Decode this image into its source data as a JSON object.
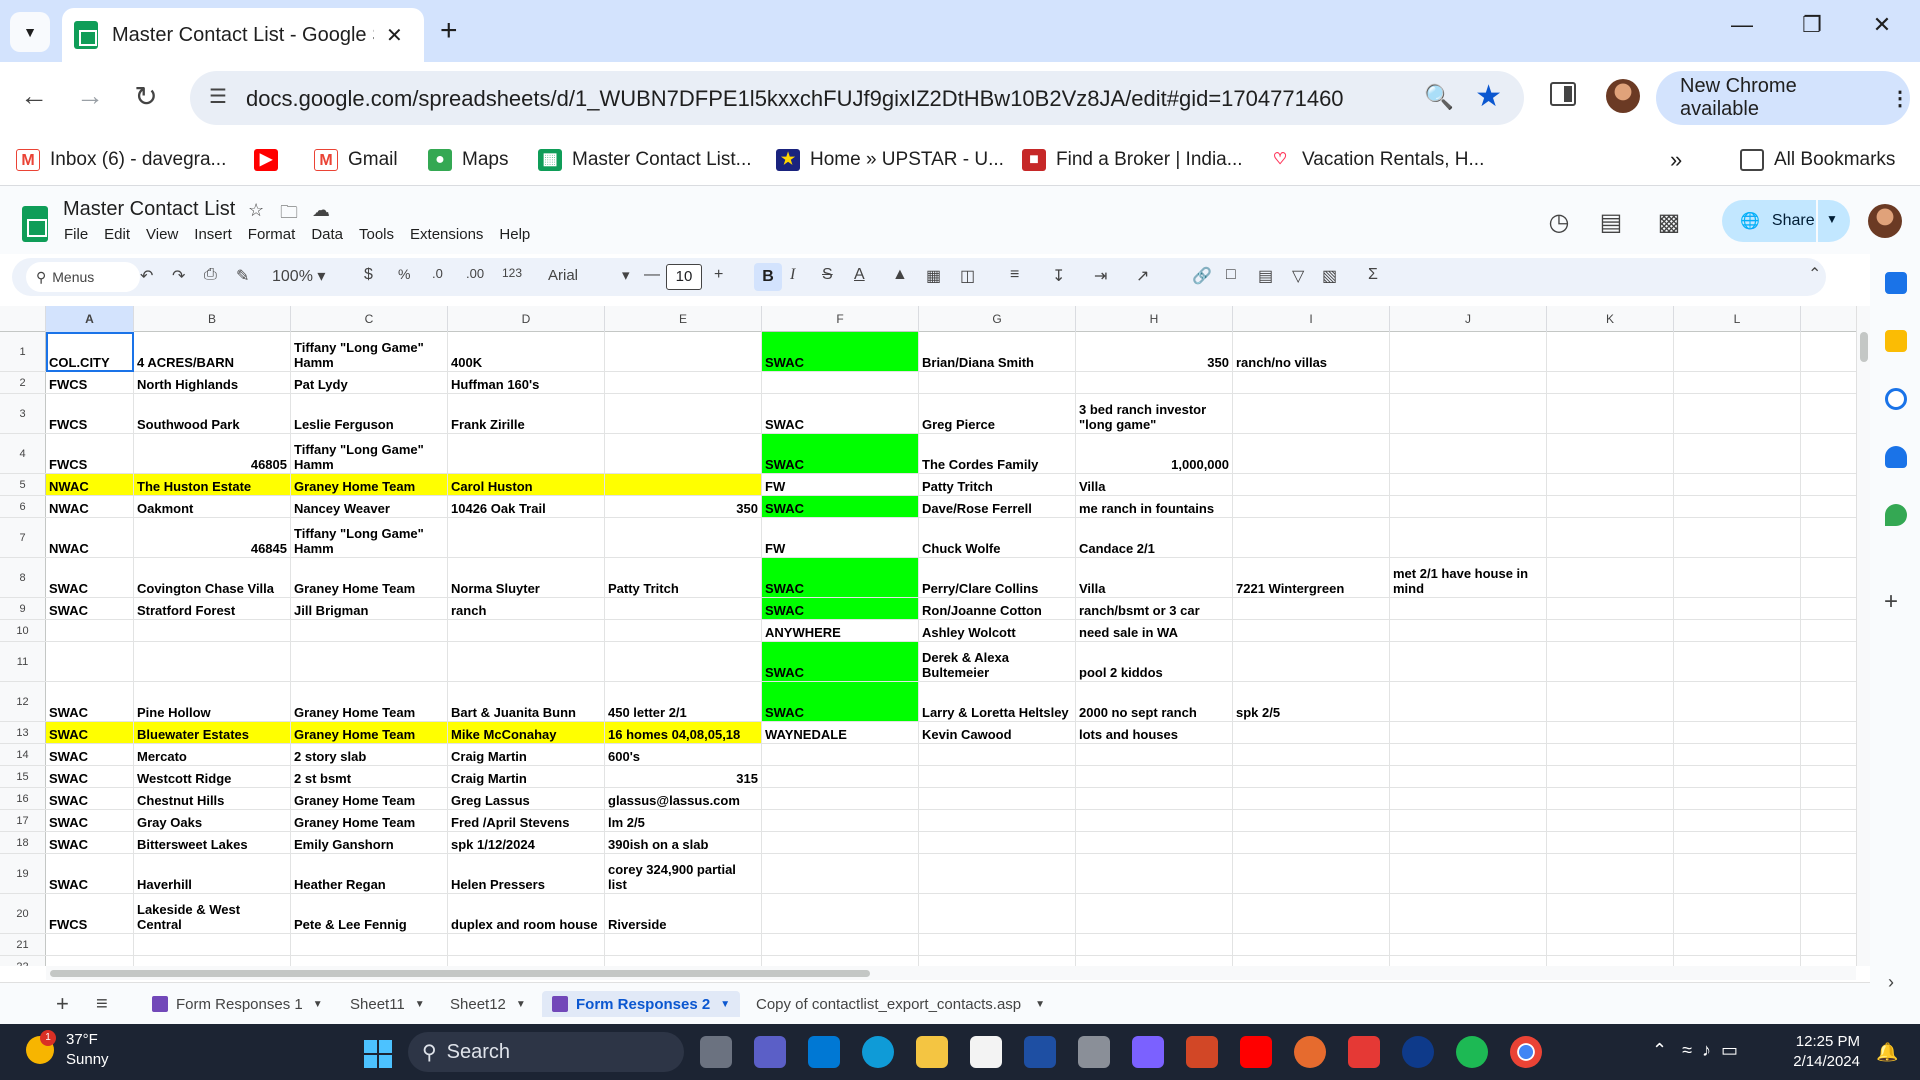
{
  "browser": {
    "tab_title": "Master Contact List - Google Sh",
    "url": "docs.google.com/spreadsheets/d/1_WUBN7DFPE1l5kxxchFUJf9gixIZ2DtHBw10B2Vz8JA/edit#gid=1704771460",
    "new_chrome_label": "New Chrome available",
    "bookmarks": [
      {
        "label": "Inbox (6) - davegra...",
        "icon": "gmail-icon",
        "color": "#ea4335"
      },
      {
        "label": "",
        "icon": "youtube-icon",
        "color": "#ff0000"
      },
      {
        "label": "Gmail",
        "icon": "gmail-icon",
        "color": "#ea4335"
      },
      {
        "label": "Maps",
        "icon": "maps-icon",
        "color": "#34a853"
      },
      {
        "label": "Master Contact List...",
        "icon": "sheets-icon",
        "color": "#0f9d58"
      },
      {
        "label": "Home » UPSTAR - U...",
        "icon": "upstar-icon",
        "color": "#1a237e"
      },
      {
        "label": "Find a Broker | India...",
        "icon": "broker-icon",
        "color": "#c62828"
      },
      {
        "label": "Vacation Rentals, H...",
        "icon": "airbnb-icon",
        "color": "#ff385c"
      }
    ],
    "all_bookmarks_label": "All Bookmarks"
  },
  "sheets": {
    "doc_title": "Master Contact List",
    "menu": [
      "File",
      "Edit",
      "View",
      "Insert",
      "Format",
      "Data",
      "Tools",
      "Extensions",
      "Help"
    ],
    "share_label": "Share",
    "toolbar": {
      "menus_label": "Menus",
      "zoom": "100%",
      "currency": "$",
      "percent": "%",
      "dec_decrease": ".0",
      "dec_increase": ".00",
      "number_format": "123",
      "font": "Arial",
      "font_size": "10"
    },
    "columns": [
      "A",
      "B",
      "C",
      "D",
      "E",
      "F",
      "G",
      "H",
      "I",
      "J",
      "K",
      "L"
    ],
    "rows": [
      {
        "n": "1",
        "cells": [
          "COL.CITY",
          "4 ACRES/BARN",
          "Tiffany \"Long Game\" Hamm",
          "400K",
          "",
          "SWAC",
          "Brian/Diana Smith",
          "350",
          "ranch/no villas",
          "",
          "",
          ""
        ]
      },
      {
        "n": "2",
        "cells": [
          "FWCS",
          "North Highlands",
          "Pat Lydy",
          "Huffman 160's",
          "",
          "",
          "",
          "",
          "",
          "",
          "",
          ""
        ]
      },
      {
        "n": "3",
        "cells": [
          "FWCS",
          "Southwood Park",
          "Leslie Ferguson",
          "Frank Zirille",
          "",
          "SWAC",
          "Greg Pierce",
          "3 bed  ranch investor \"long game\"",
          "",
          "",
          "",
          ""
        ]
      },
      {
        "n": "4",
        "cells": [
          "FWCS",
          "46805",
          "Tiffany \"Long Game\" Hamm",
          "",
          "",
          "SWAC",
          "The Cordes Family",
          "1,000,000",
          "",
          "",
          "",
          ""
        ]
      },
      {
        "n": "5",
        "cells": [
          "NWAC",
          "The Huston Estate",
          "Graney Home Team",
          "Carol Huston",
          "",
          "FW",
          "Patty Tritch",
          "Villa",
          "",
          "",
          "",
          ""
        ]
      },
      {
        "n": "6",
        "cells": [
          "NWAC",
          "Oakmont",
          "Nancey Weaver",
          "10426 Oak Trail",
          "350",
          "SWAC",
          "Dave/Rose Ferrell",
          "me ranch in fountains",
          "",
          "",
          "",
          ""
        ]
      },
      {
        "n": "7",
        "cells": [
          "NWAC",
          "46845",
          "Tiffany \"Long Game\" Hamm",
          "",
          "",
          "FW",
          "Chuck Wolfe",
          "Candace 2/1",
          "",
          "",
          "",
          ""
        ]
      },
      {
        "n": "8",
        "cells": [
          "SWAC",
          "Covington Chase Villa",
          "Graney Home Team",
          "Norma Sluyter",
          "Patty Tritch",
          "SWAC",
          "Perry/Clare Collins",
          "Villa",
          "7221 Wintergreen",
          "met 2/1 have house in mind",
          "",
          ""
        ]
      },
      {
        "n": "9",
        "cells": [
          "SWAC",
          "Stratford Forest",
          "Jill Brigman",
          "ranch",
          "",
          "SWAC",
          "Ron/Joanne Cotton",
          "ranch/bsmt or 3 car",
          "",
          "",
          "",
          ""
        ]
      },
      {
        "n": "10",
        "cells": [
          "",
          "",
          "",
          "",
          "",
          "ANYWHERE",
          "Ashley Wolcott",
          "need sale in WA",
          "",
          "",
          "",
          ""
        ]
      },
      {
        "n": "11",
        "cells": [
          "",
          "",
          "",
          "",
          "",
          "SWAC",
          "Derek & Alexa Bultemeier",
          "pool 2 kiddos",
          "",
          "",
          "",
          ""
        ]
      },
      {
        "n": "12",
        "cells": [
          "SWAC",
          "Pine Hollow",
          "Graney Home Team",
          "Bart & Juanita Bunn",
          "450 letter 2/1",
          "SWAC",
          "Larry & Loretta Heltsley",
          "2000 no sept ranch",
          "spk 2/5",
          "",
          "",
          ""
        ]
      },
      {
        "n": "13",
        "cells": [
          "SWAC",
          "Bluewater Estates",
          "Graney Home Team",
          "Mike McConahay",
          "16 homes 04,08,05,18",
          "WAYNEDALE",
          "Kevin Cawood",
          "lots and houses",
          "",
          "",
          "",
          ""
        ]
      },
      {
        "n": "14",
        "cells": [
          "SWAC",
          "Mercato",
          "2 story slab",
          "Craig Martin",
          "600's",
          "",
          "",
          "",
          "",
          "",
          "",
          ""
        ]
      },
      {
        "n": "15",
        "cells": [
          "SWAC",
          "Westcott Ridge",
          "2 st bsmt",
          "Craig Martin",
          "315",
          "",
          "",
          "",
          "",
          "",
          "",
          ""
        ]
      },
      {
        "n": "16",
        "cells": [
          "SWAC",
          "Chestnut Hills",
          "Graney Home Team",
          "Greg Lassus",
          "glassus@lassus.com",
          "",
          "",
          "",
          "",
          "",
          "",
          ""
        ]
      },
      {
        "n": "17",
        "cells": [
          "SWAC",
          "Gray Oaks",
          "Graney Home Team",
          "Fred /April Stevens",
          "lm 2/5",
          "",
          "",
          "",
          "",
          "",
          "",
          ""
        ]
      },
      {
        "n": "18",
        "cells": [
          "SWAC",
          "Bittersweet Lakes",
          "Emily Ganshorn",
          "spk 1/12/2024",
          "390ish on a slab",
          "",
          "",
          "",
          "",
          "",
          "",
          ""
        ]
      },
      {
        "n": "19",
        "cells": [
          "SWAC",
          "Haverhill",
          "Heather Regan",
          "Helen Pressers",
          "corey 324,900 partial list",
          "",
          "",
          "",
          "",
          "",
          "",
          ""
        ]
      },
      {
        "n": "20",
        "cells": [
          "FWCS",
          "Lakeside & West Central",
          "Pete & Lee Fennig",
          "duplex and room house",
          "Riverside",
          "",
          "",
          "",
          "",
          "",
          "",
          ""
        ]
      },
      {
        "n": "21",
        "cells": [
          "",
          "",
          "",
          "",
          "",
          "",
          "",
          "",
          "",
          "",
          "",
          ""
        ]
      },
      {
        "n": "22",
        "cells": [
          "",
          "",
          "",
          "",
          "",
          "",
          "",
          "",
          "",
          "",
          "",
          ""
        ]
      }
    ],
    "sheet_tabs": [
      "Form Responses 1",
      "Sheet11",
      "Sheet12",
      "Form Responses 2",
      "Copy of contactlist_export_contacts.asp"
    ],
    "active_sheet": "Form Responses 2",
    "highlight_colors": {
      "green": "#00ff00",
      "yellow": "#ffff00",
      "selection": "#1a73e8"
    }
  },
  "taskbar": {
    "temperature": "37°F",
    "condition": "Sunny",
    "weather_badge": "1",
    "search_label": "Search",
    "time": "12:25 PM",
    "date": "2/14/2024"
  }
}
